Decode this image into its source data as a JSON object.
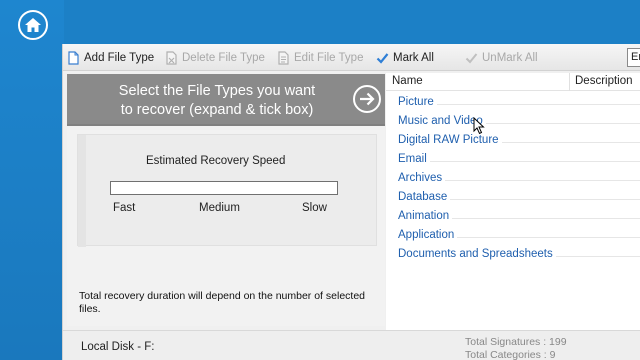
{
  "toolbar": {
    "add_file_type": "Add File Type",
    "delete_file_type": "Delete File Type",
    "edit_file_type": "Edit File Type",
    "mark_all": "Mark All",
    "unmark_all": "UnMark All",
    "search_value": "Er"
  },
  "left_panel": {
    "header_line1": "Select the File Types you want",
    "header_line2": "to recover (expand & tick box)",
    "speed_title": "Estimated Recovery Speed",
    "speed_fast": "Fast",
    "speed_medium": "Medium",
    "speed_slow": "Slow",
    "note": "Total recovery duration will depend on the number of selected files."
  },
  "list": {
    "col_name": "Name",
    "col_description": "Description",
    "items": [
      {
        "label": "Picture"
      },
      {
        "label": "Music and Video"
      },
      {
        "label": "Digital RAW Picture"
      },
      {
        "label": "Email"
      },
      {
        "label": "Archives"
      },
      {
        "label": "Database"
      },
      {
        "label": "Animation"
      },
      {
        "label": "Application"
      },
      {
        "label": "Documents and Spreadsheets"
      }
    ]
  },
  "status": {
    "disk_label": "Local Disk - F:",
    "total_signatures": "Total Signatures : 199",
    "total_categories": "Total Categories : 9"
  },
  "colors": {
    "accent_blue": "#1c7ec4",
    "link_blue": "#1f5fae",
    "panel_gray": "#808080"
  },
  "icons": [
    "home-icon",
    "add-file-icon",
    "delete-file-icon",
    "edit-file-icon",
    "checkmark-icon",
    "unmark-icon",
    "arrow-right-icon",
    "mouse-cursor-icon"
  ]
}
